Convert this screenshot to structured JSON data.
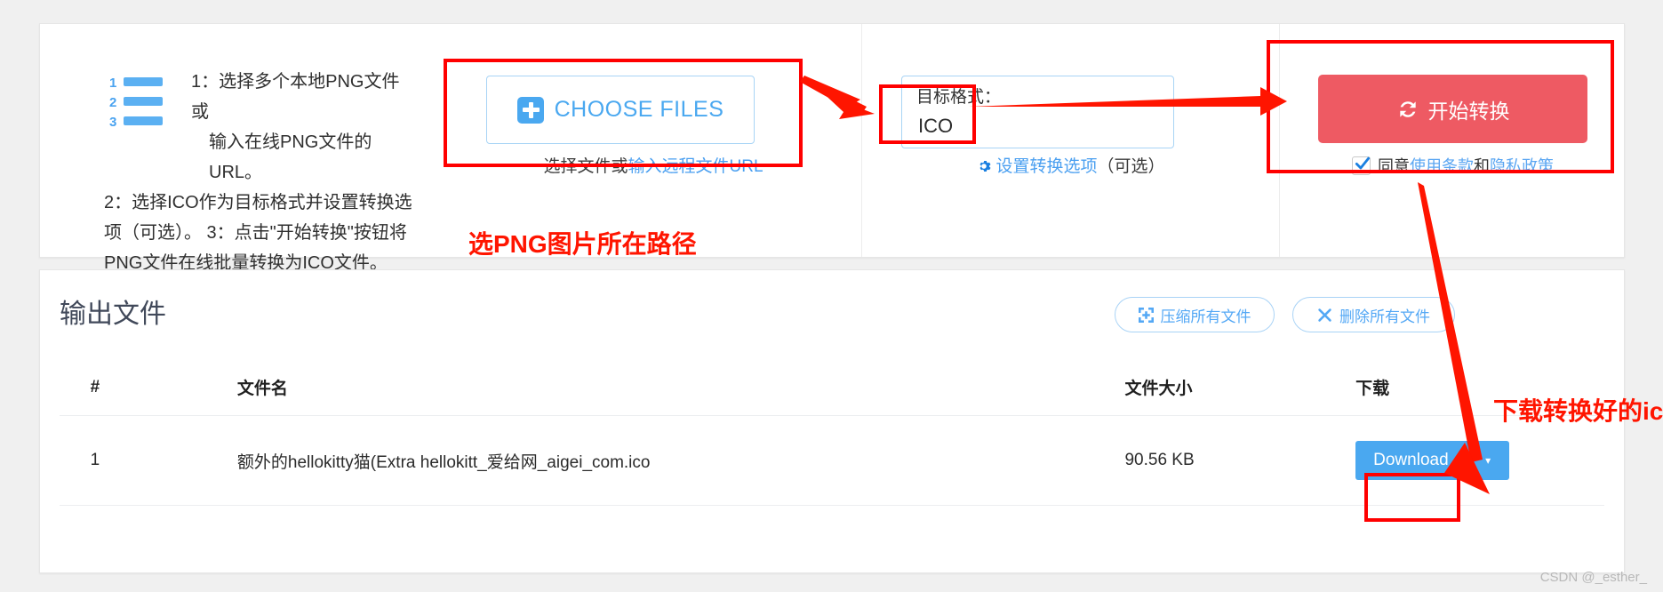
{
  "instructions": {
    "line1": "1：选择多个本地PNG文件或",
    "line2": "输入在线PNG文件的URL。",
    "rest": "2：选择ICO作为目标格式并设置转换选项（可选）。 3：点击\"开始转换\"按钮将PNG文件在线批量转换为ICO文件。",
    "icon_numbers": [
      "1",
      "2",
      "3"
    ]
  },
  "choose": {
    "button_label": "CHOOSE FILES",
    "sub_static": "选择文件或",
    "sub_link": "输入远程文件URL"
  },
  "format": {
    "label": "目标格式：",
    "value": "ICO",
    "settings_link": "设置转换选项",
    "settings_optional": "（可选）"
  },
  "convert": {
    "button_label": "开始转换",
    "agree_prefix": "同意",
    "agree_terms": "使用条款",
    "agree_and": "和",
    "agree_privacy": "隐私政策"
  },
  "output": {
    "title": "输出文件",
    "zip_all": "压缩所有文件",
    "delete_all": "删除所有文件",
    "columns": [
      "#",
      "文件名",
      "文件大小",
      "下载"
    ],
    "rows": [
      {
        "index": "1",
        "filename": "额外的hellokitty猫(Extra hellokitt_爱给网_aigei_com.ico",
        "size": "90.56 KB",
        "download_label": "Download",
        "caret": "▾"
      }
    ]
  },
  "annotations": {
    "choose_path": "选PNG图片所在路径",
    "download_ico": "下载转换好的ic"
  },
  "watermark": "CSDN @_esther_",
  "colors": {
    "accent_blue": "#4aa8f0",
    "convert_red": "#ee5a63",
    "annotation_red": "#ff1500",
    "page_bg": "#f0f0f0"
  }
}
